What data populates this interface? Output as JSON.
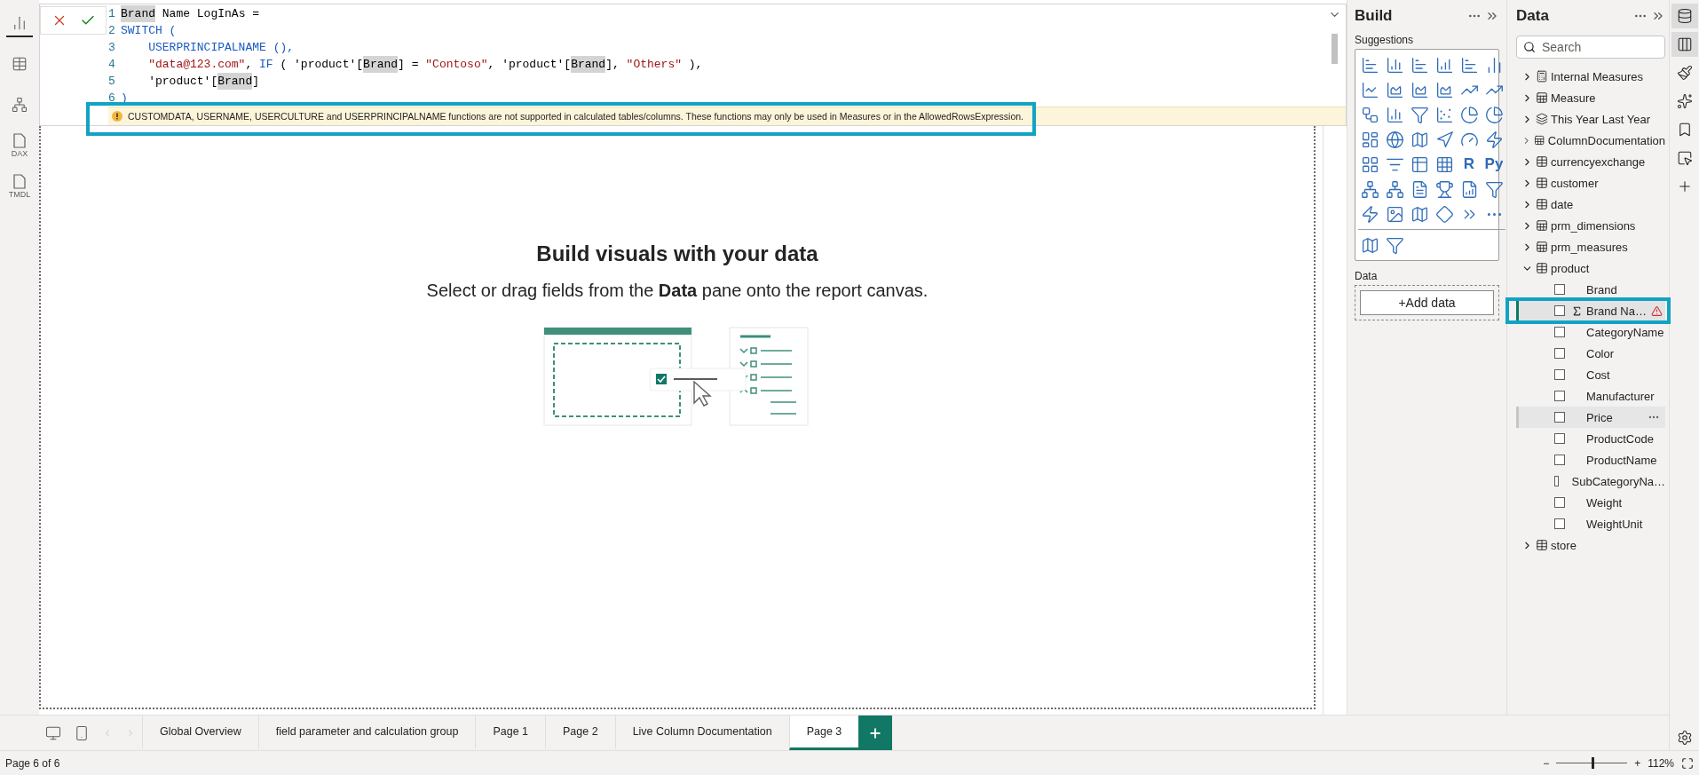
{
  "left_rail": [
    {
      "selected": true
    },
    {
      "selected": false
    },
    {
      "selected": false
    },
    {
      "selected": false,
      "caption": "DAX"
    },
    {
      "selected": false,
      "caption": "TMDL"
    }
  ],
  "formula": {
    "lines": [
      {
        "number": "1",
        "tokens": [
          {
            "text": "Brand",
            "kind": "match"
          },
          {
            "text": " Name LogInAs =",
            "kind": "plain"
          }
        ]
      },
      {
        "number": "2",
        "tokens": [
          {
            "text": "SWITCH (",
            "kind": "keyword"
          }
        ]
      },
      {
        "number": "3",
        "tokens": [
          {
            "text": "    USERPRINCIPALNAME (),",
            "kind": "keyword"
          }
        ]
      },
      {
        "number": "4",
        "tokens": [
          {
            "text": "    \"data@123.com\"",
            "kind": "string"
          },
          {
            "text": ", ",
            "kind": "plain"
          },
          {
            "text": "IF",
            "kind": "keyword"
          },
          {
            "text": " ( 'product'[",
            "kind": "plain"
          },
          {
            "text": "Brand",
            "kind": "match"
          },
          {
            "text": "] = ",
            "kind": "plain"
          },
          {
            "text": "\"Contoso\"",
            "kind": "string"
          },
          {
            "text": ", 'product'[",
            "kind": "plain"
          },
          {
            "text": "Brand",
            "kind": "match"
          },
          {
            "text": "], ",
            "kind": "plain"
          },
          {
            "text": "\"Others\"",
            "kind": "string"
          },
          {
            "text": " ),",
            "kind": "plain"
          }
        ]
      },
      {
        "number": "5",
        "tokens": [
          {
            "text": "    'product'[",
            "kind": "plain"
          },
          {
            "text": "Brand",
            "kind": "match"
          },
          {
            "text": "]",
            "kind": "plain"
          }
        ]
      },
      {
        "number": "6",
        "tokens": [
          {
            "text": ")",
            "kind": "keyword"
          }
        ]
      }
    ],
    "warning": {
      "text": "CUSTOMDATA, USERNAME, USERCULTURE and USERPRINCIPALNAME functions are not supported in calculated tables/columns. These functions may only be used in Measures or in the AllowedRowsExpression.",
      "highlighted": true
    }
  },
  "empty_state": {
    "title": "Build visuals with your data",
    "subtitle": "Select or drag fields from the **Data** pane onto the report canvas."
  },
  "build_pane": {
    "title": "Build",
    "suggestions_label": "Suggestions",
    "text_visuals": [
      "R",
      "Py"
    ],
    "data_label": "Data",
    "add_data": "+Add data"
  },
  "data_pane": {
    "title": "Data",
    "search": {
      "placeholder": "Search"
    },
    "tables": [
      {
        "name": "Internal Measures",
        "kind": "calculator",
        "expanded": false
      },
      {
        "name": "Measure",
        "kind": "measures",
        "expanded": false
      },
      {
        "name": "This Year Last Year",
        "kind": "group",
        "expanded": false
      },
      {
        "name": "ColumnDocumentation",
        "kind": "measures",
        "expanded": false
      },
      {
        "name": "currencyexchange",
        "kind": "table",
        "expanded": false
      },
      {
        "name": "customer",
        "kind": "table",
        "expanded": false
      },
      {
        "name": "date",
        "kind": "table",
        "expanded": false
      },
      {
        "name": "prm_dimensions",
        "kind": "measures",
        "expanded": false
      },
      {
        "name": "prm_measures",
        "kind": "measures",
        "expanded": false
      },
      {
        "name": "product",
        "kind": "table",
        "expanded": true,
        "fields": [
          {
            "name": "Brand",
            "kind": "column",
            "checked": false,
            "selected": false,
            "hovered": false,
            "warning": false,
            "highlighted": false
          },
          {
            "name": "Brand Na…",
            "kind": "calculated",
            "checked": false,
            "selected": true,
            "hovered": false,
            "warning": true,
            "highlighted": true
          },
          {
            "name": "CategoryName",
            "kind": "column",
            "checked": false,
            "selected": false,
            "hovered": false,
            "warning": false,
            "highlighted": false
          },
          {
            "name": "Color",
            "kind": "column",
            "checked": false,
            "selected": false,
            "hovered": false,
            "warning": false,
            "highlighted": false
          },
          {
            "name": "Cost",
            "kind": "column",
            "checked": false,
            "selected": false,
            "hovered": false,
            "warning": false,
            "highlighted": false
          },
          {
            "name": "Manufacturer",
            "kind": "column",
            "checked": false,
            "selected": false,
            "hovered": false,
            "warning": false,
            "highlighted": false
          },
          {
            "name": "Price",
            "kind": "column",
            "checked": false,
            "selected": false,
            "hovered": true,
            "warning": false,
            "highlighted": false
          },
          {
            "name": "ProductCode",
            "kind": "column",
            "checked": false,
            "selected": false,
            "hovered": false,
            "warning": false,
            "highlighted": false
          },
          {
            "name": "ProductName",
            "kind": "column",
            "checked": false,
            "selected": false,
            "hovered": false,
            "warning": false,
            "highlighted": false
          },
          {
            "name": "SubCategoryNa…",
            "kind": "column",
            "checked": false,
            "selected": false,
            "hovered": false,
            "warning": false,
            "highlighted": false
          },
          {
            "name": "Weight",
            "kind": "column",
            "checked": false,
            "selected": false,
            "hovered": false,
            "warning": false,
            "highlighted": false
          },
          {
            "name": "WeightUnit",
            "kind": "column",
            "checked": false,
            "selected": false,
            "hovered": false,
            "warning": false,
            "highlighted": false
          }
        ]
      },
      {
        "name": "store",
        "kind": "table",
        "expanded": false
      }
    ]
  },
  "right_rail": [
    {
      "selected": true
    },
    {
      "selected": true
    },
    {
      "selected": false
    },
    {
      "selected": false
    },
    {
      "selected": false
    },
    {
      "selected": false
    },
    {
      "selected": false
    }
  ],
  "page_tabs": [
    {
      "label": "Global Overview",
      "selected": false
    },
    {
      "label": "field parameter and calculation group",
      "selected": false
    },
    {
      "label": "Page 1",
      "selected": false
    },
    {
      "label": "Page 2",
      "selected": false
    },
    {
      "label": "Live Column Documentation",
      "selected": false
    },
    {
      "label": "Page 3",
      "selected": true
    }
  ],
  "status_bar": {
    "page": "Page 6 of 6",
    "zoom_out": "−",
    "zoom_in": "+",
    "zoom": {
      "level": 0.5
    },
    "zoom_reading": "112%"
  }
}
